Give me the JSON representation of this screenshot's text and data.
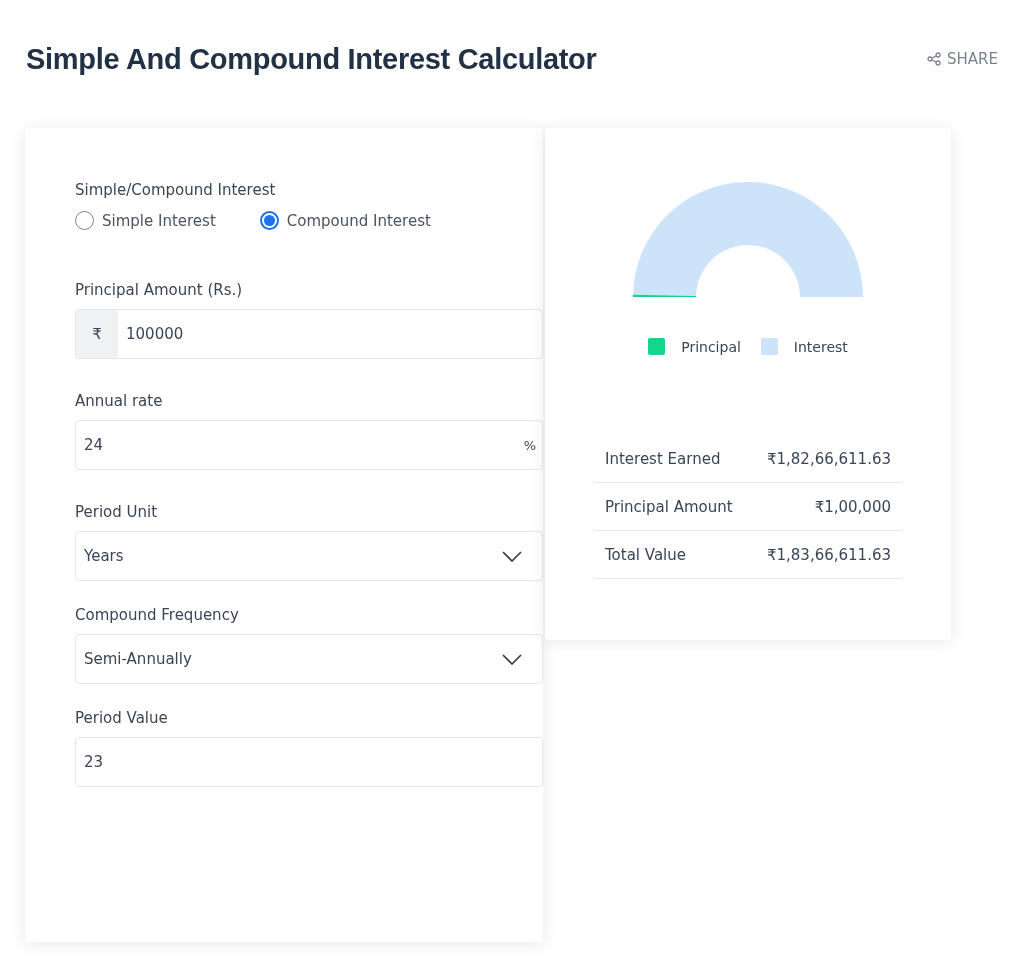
{
  "header": {
    "title": "Simple And Compound Interest Calculator",
    "share": "SHARE"
  },
  "form": {
    "interest_type": {
      "label": "Simple/Compound Interest",
      "options": [
        {
          "label": "Simple Interest",
          "selected": false
        },
        {
          "label": "Compound Interest",
          "selected": true
        }
      ]
    },
    "fields": [
      {
        "kind": "prefixed",
        "label": "Principal Amount (Rs.)",
        "prefix": "₹",
        "value": "100000"
      },
      {
        "kind": "suffixed",
        "label": "Annual rate",
        "value": "24",
        "suffix": "%"
      },
      {
        "kind": "select",
        "label": "Period Unit",
        "value": "Years"
      },
      {
        "kind": "select",
        "label": "Compound Frequency",
        "value": "Semi-Annually"
      },
      {
        "kind": "plain",
        "label": "Period Value",
        "value": "23"
      }
    ]
  },
  "results": {
    "legend": [
      {
        "label": "Principal",
        "color": "#14d68b"
      },
      {
        "label": "Interest",
        "color": "#cce3fa"
      }
    ],
    "rows": [
      {
        "label": "Interest Earned",
        "value": "₹1,82,66,611.63"
      },
      {
        "label": "Principal Amount",
        "value": "₹1,00,000"
      },
      {
        "label": "Total Value",
        "value": "₹1,83,66,611.63"
      }
    ]
  }
}
